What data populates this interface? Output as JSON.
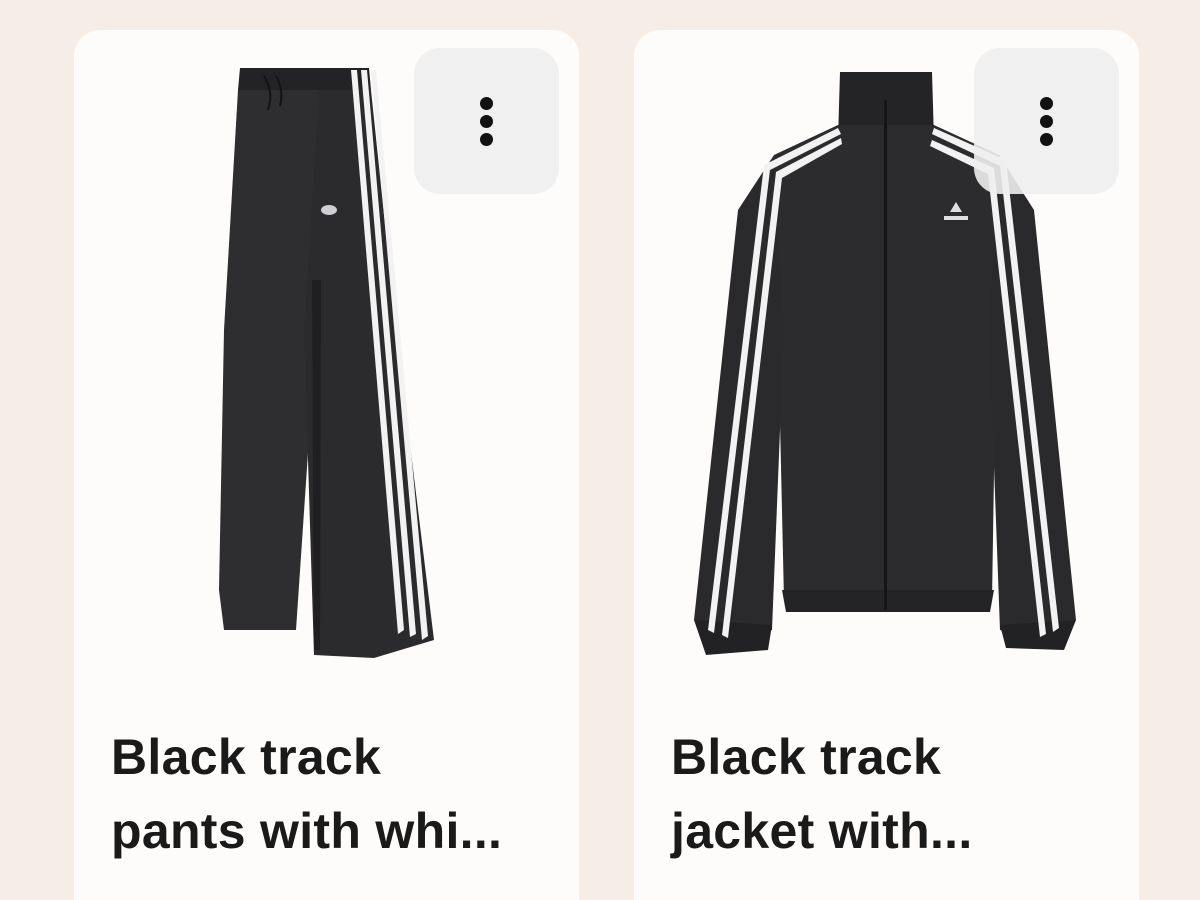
{
  "cards": [
    {
      "title_line1": "Black track",
      "title_line2": "pants with whi...",
      "image_subject": "black-track-pants",
      "menu_icon": "more-vertical-icon"
    },
    {
      "title_line1": "Black track",
      "title_line2": "jacket with...",
      "image_subject": "black-track-jacket",
      "menu_icon": "more-vertical-icon"
    }
  ],
  "colors": {
    "page_background": "#f6ede7",
    "card_background": "#fdfcfa",
    "menu_button_background": "#eeeef0",
    "garment": "#2b2b2d",
    "stripe": "#f2f2f2",
    "text": "#1a1a1a"
  }
}
